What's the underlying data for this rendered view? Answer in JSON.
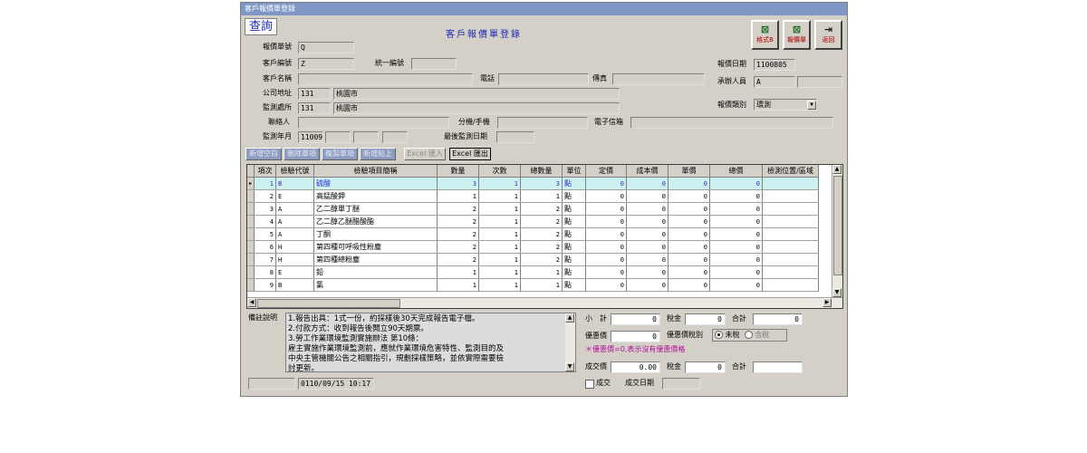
{
  "window": {
    "title": "客戶報價單登錄"
  },
  "mode_label": "查詢",
  "form_title": "客戶報價單登錄",
  "buttons": {
    "format_b": "格式B",
    "quote": "報價單",
    "back": "返回"
  },
  "fields": {
    "quote_no": {
      "label": "報價單號",
      "value": "Q"
    },
    "customer_no": {
      "label": "客戶編號",
      "value": "Z"
    },
    "tax_id": {
      "label": "統一編號",
      "value": ""
    },
    "customer_name": {
      "label": "客戶名稱",
      "value": ""
    },
    "phone": {
      "label": "電話",
      "value": ""
    },
    "fax": {
      "label": "傳真",
      "value": ""
    },
    "company_addr": {
      "label": "公司地址",
      "code": "131",
      "city": "桃園市"
    },
    "monitor_site": {
      "label": "監測處所",
      "code": "131",
      "city": "桃園市"
    },
    "contact": {
      "label": "聯絡人",
      "value": ""
    },
    "ext_mobile": {
      "label": "分機/手機",
      "value": ""
    },
    "email": {
      "label": "電子信箱",
      "value": ""
    },
    "monitor_ym": {
      "label": "監測年月",
      "value": "11009"
    },
    "last_monitor": {
      "label": "最後監測日期",
      "value": ""
    },
    "quote_date": {
      "label": "報價日期",
      "value": "1100805"
    },
    "handler": {
      "label": "承辦人員",
      "value": "A"
    },
    "quote_type": {
      "label": "報價類別",
      "value": "環測"
    }
  },
  "toolbar": [
    "新增空白",
    "刪除單項",
    "複製單項",
    "新增貼上",
    "Excel 匯入",
    "Excel 匯出"
  ],
  "grid": {
    "columns": [
      "項次",
      "檢驗代號",
      "檢驗項目簡稱",
      "數量",
      "次數",
      "總數量",
      "單位",
      "定價",
      "成本價",
      "單價",
      "總價",
      "檢測位置/區域"
    ],
    "rows": [
      [
        "1",
        "B",
        "硫酸",
        "3",
        "1",
        "3",
        "點",
        "0",
        "0",
        "0",
        "0",
        ""
      ],
      [
        "2",
        "E",
        "高錳酸鉀",
        "1",
        "1",
        "1",
        "點",
        "0",
        "0",
        "0",
        "0",
        ""
      ],
      [
        "3",
        "A",
        "乙二醇單丁醚",
        "2",
        "1",
        "2",
        "點",
        "0",
        "0",
        "0",
        "0",
        ""
      ],
      [
        "4",
        "A",
        "乙二醇乙醚醋酸酯",
        "2",
        "1",
        "2",
        "點",
        "0",
        "0",
        "0",
        "0",
        ""
      ],
      [
        "5",
        "A",
        "丁酮",
        "2",
        "1",
        "2",
        "點",
        "0",
        "0",
        "0",
        "0",
        ""
      ],
      [
        "6",
        "H",
        "第四種可呼吸性粉塵",
        "2",
        "1",
        "2",
        "點",
        "0",
        "0",
        "0",
        "0",
        ""
      ],
      [
        "7",
        "H",
        "第四種總粉塵",
        "2",
        "1",
        "2",
        "點",
        "0",
        "0",
        "0",
        "0",
        ""
      ],
      [
        "8",
        "E",
        "鉛",
        "1",
        "1",
        "1",
        "點",
        "0",
        "0",
        "0",
        "0",
        ""
      ],
      [
        "9",
        "B",
        "氯",
        "1",
        "1",
        "1",
        "點",
        "0",
        "0",
        "0",
        "0",
        ""
      ]
    ]
  },
  "memo": {
    "label": "備註說明",
    "lines": [
      "1.報告出具：1式一份，約採樣後30天完成報告電子檔。",
      "2.付款方式：收到報告後開立90天期票。",
      "3.勞工作業環境監測實施辦法 第10條：",
      "雇主實施作業環境監測前，應就作業環境危害特性、監測目的及",
      "中央主管機關公告之相關指引，規劃採樣策略，並依實際需要檢",
      "討更新。"
    ]
  },
  "totals": {
    "subtotal_label": "小　計",
    "subtotal": "0",
    "tax_label": "稅金",
    "tax": "0",
    "total_label": "合計",
    "total": "0",
    "discount_label": "優惠價",
    "discount": "0",
    "discount_tax_label": "優惠價稅別",
    "tax_options": [
      "未稅",
      "含稅"
    ],
    "note": "＊優惠價=0,表示沒有優惠價格",
    "deal_label": "成交價",
    "deal": "0.00",
    "deal_tax_label": "稅金",
    "deal_tax": "0",
    "deal_total_label": "合計",
    "deal_total": "",
    "deal_check_label": "成交",
    "deal_date_label": "成交日期"
  },
  "status": {
    "left": "",
    "timestamp": "0110/09/15 10:17"
  }
}
